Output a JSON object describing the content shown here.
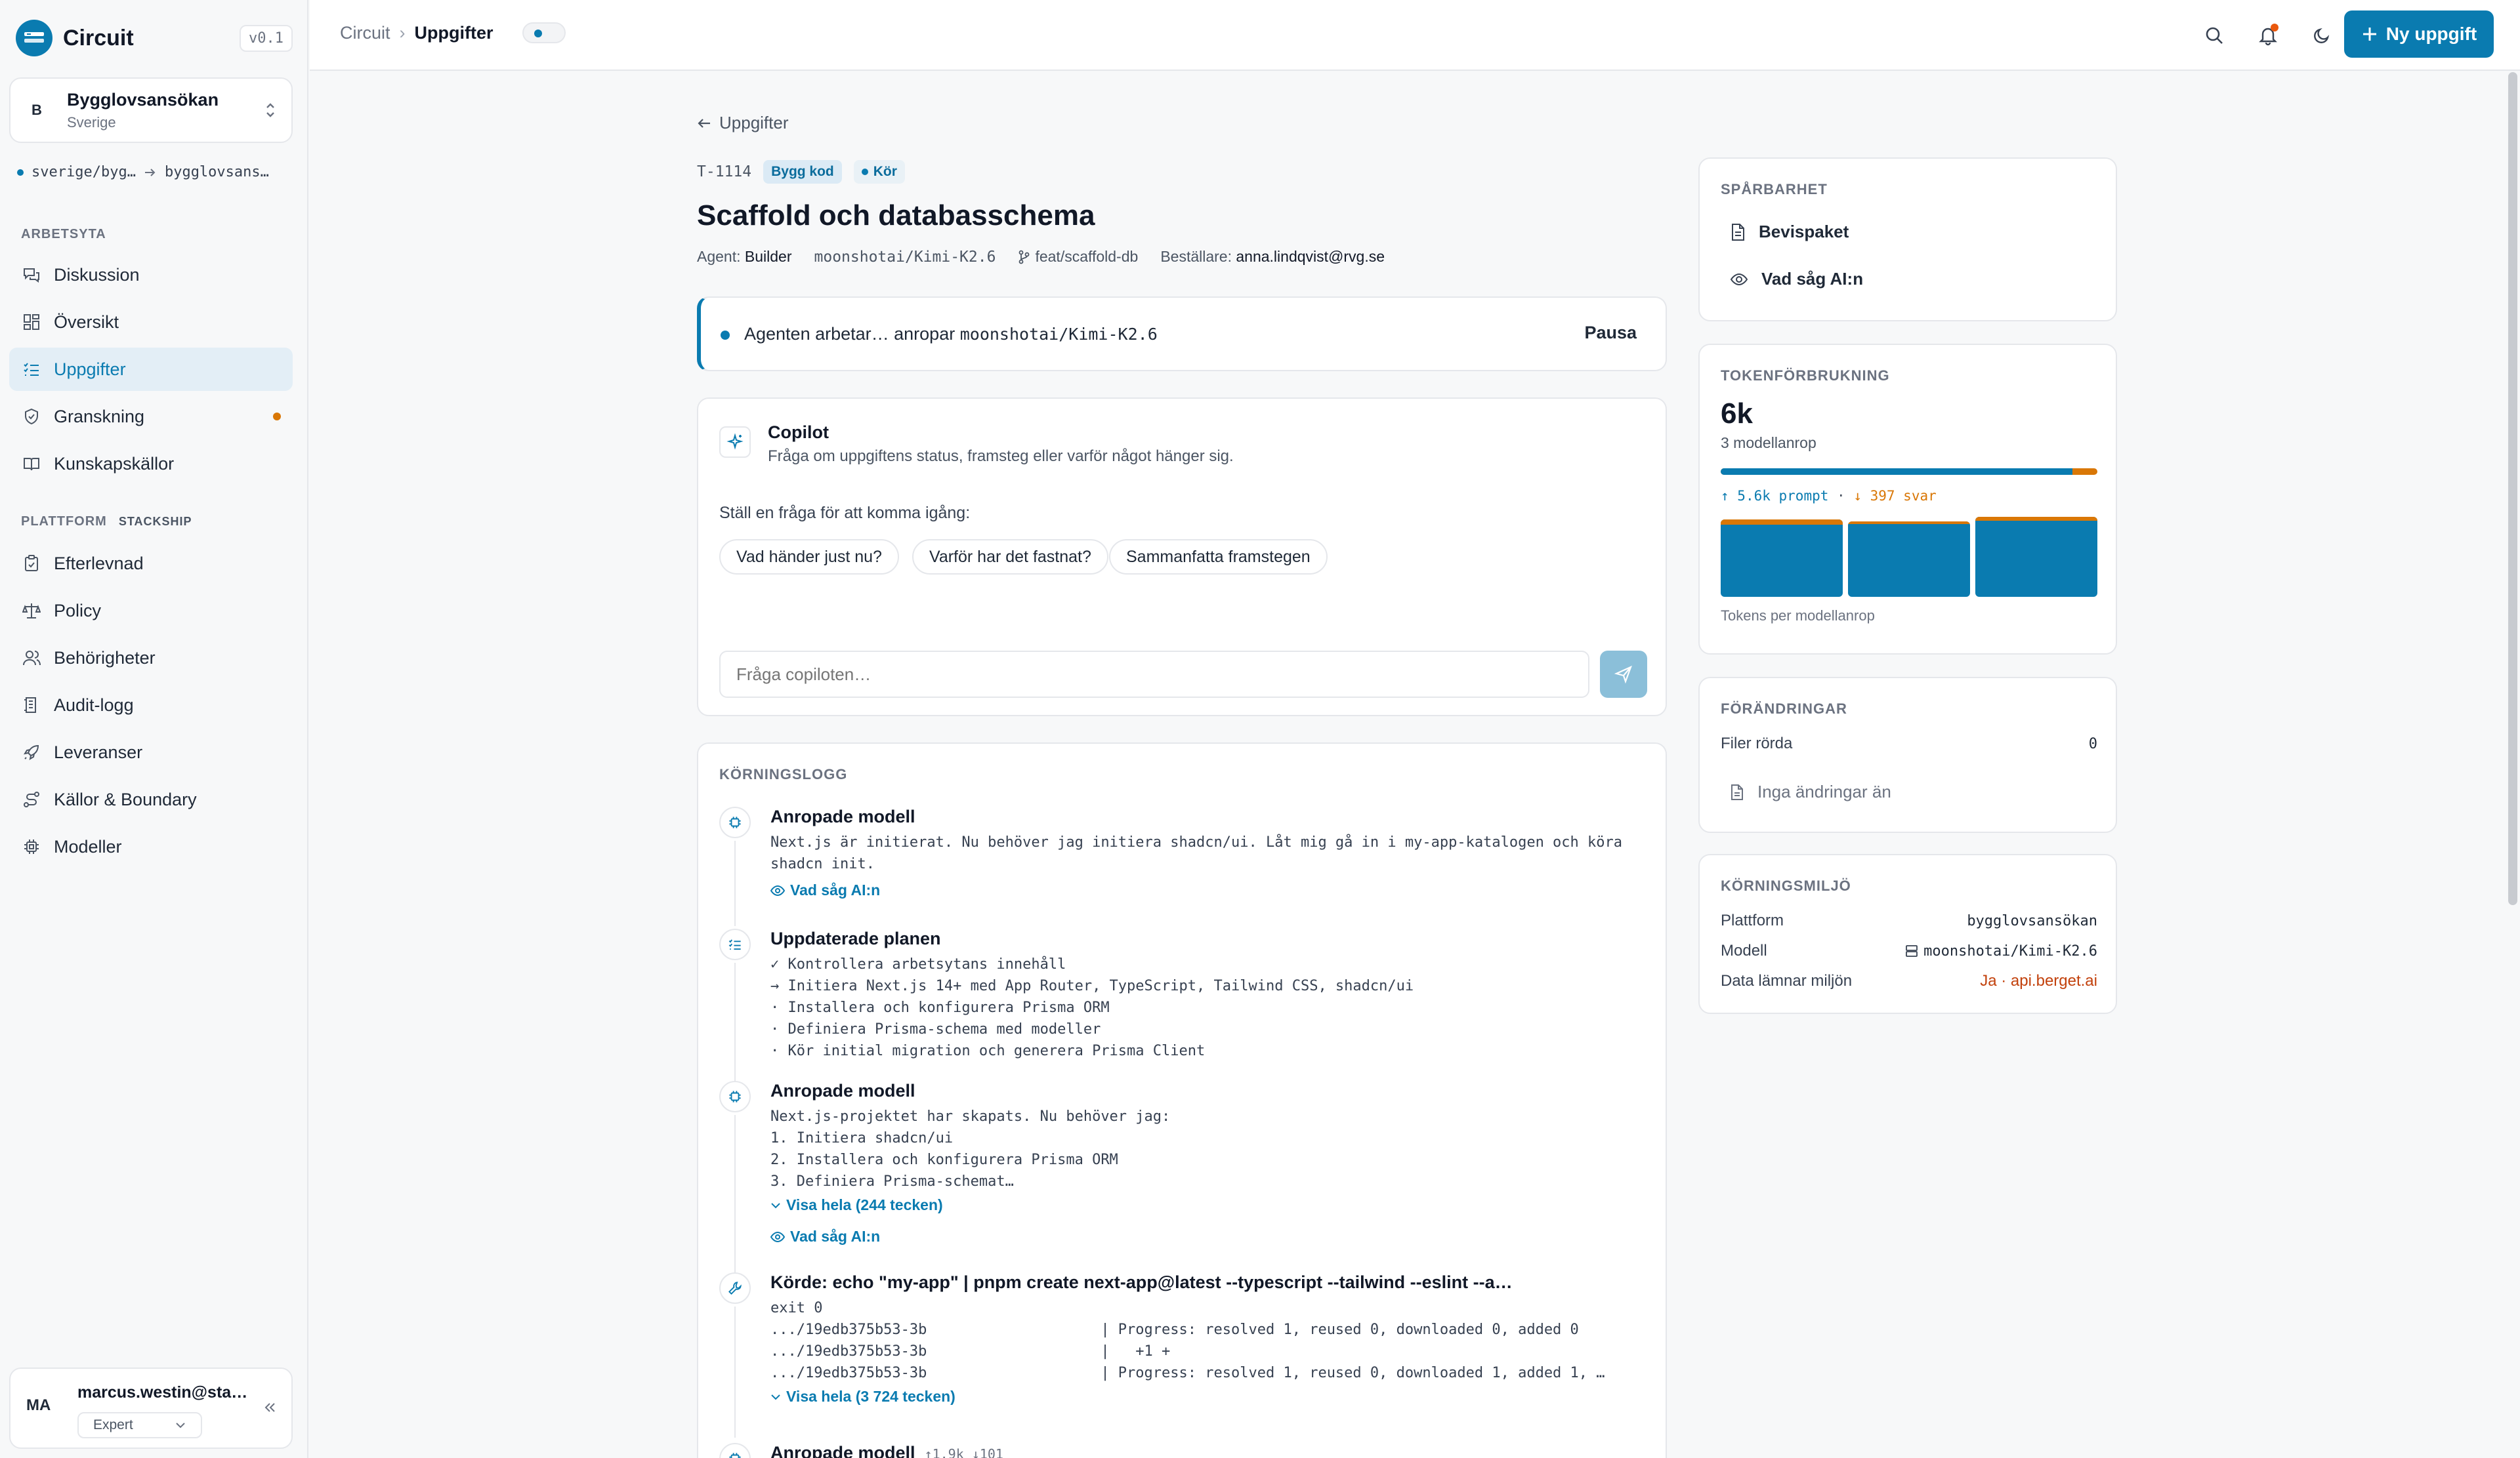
{
  "app": {
    "name": "Circuit",
    "version": "v0.1",
    "logo_icon": "circuit-logo-icon"
  },
  "project": {
    "initial": "B",
    "name": "Bygglovsansökan",
    "region": "Sverige"
  },
  "path": {
    "from": "sverige/byg…",
    "to": "bygglovsans…"
  },
  "sidebar": {
    "workspace_label": "ARBETSYTA",
    "workspace_items": [
      {
        "label": "Diskussion",
        "icon": "chat-icon"
      },
      {
        "label": "Översikt",
        "icon": "grid-icon"
      },
      {
        "label": "Uppgifter",
        "icon": "list-check-icon",
        "active": true
      },
      {
        "label": "Granskning",
        "icon": "shield-check-icon",
        "badge": true
      },
      {
        "label": "Kunskapskällor",
        "icon": "book-icon"
      }
    ],
    "platform_label": "PLATTFORM",
    "platform_tag": "STACKSHIP",
    "platform_items": [
      {
        "label": "Efterlevnad",
        "icon": "clipboard-check-icon"
      },
      {
        "label": "Policy",
        "icon": "scale-icon"
      },
      {
        "label": "Behörigheter",
        "icon": "users-icon"
      },
      {
        "label": "Audit-logg",
        "icon": "log-icon"
      },
      {
        "label": "Leveranser",
        "icon": "rocket-icon"
      },
      {
        "label": "Källor & Boundary",
        "icon": "route-icon"
      },
      {
        "label": "Modeller",
        "icon": "cpu-icon"
      }
    ]
  },
  "user": {
    "initials": "MA",
    "name": "marcus.westin@sta…",
    "role": "Expert"
  },
  "topbar": {
    "crumb_root": "Circuit",
    "crumb_current": "Uppgifter",
    "new_task_label": "Ny uppgift"
  },
  "task": {
    "back_label": "Uppgifter",
    "id": "T-1114",
    "kind_chip": "Bygg kod",
    "status_chip": "Kör",
    "title": "Scaffold och databasschema",
    "agent_label": "Agent:",
    "agent": "Builder",
    "model": "moonshotai/Kimi-K2.6",
    "branch": "feat/scaffold-db",
    "orderer_label": "Beställare:",
    "orderer": "anna.lindqvist@rvg.se"
  },
  "status_banner": {
    "text": "Agenten arbetar… anropar ",
    "model": "moonshotai/Kimi-K2.6",
    "pause_label": "Pausa"
  },
  "copilot": {
    "title": "Copilot",
    "subtitle": "Fråga om uppgiftens status, framsteg eller varför något hänger sig.",
    "hint": "Ställ en fråga för att komma igång:",
    "suggestions": [
      "Vad händer just nu?",
      "Varför har det fastnat?",
      "Sammanfatta framstegen"
    ],
    "placeholder": "Fråga copiloten…"
  },
  "run_log": {
    "heading": "KÖRNINGSLOGG",
    "entries": [
      {
        "title": "Anropade modell",
        "icon": "cpu-icon",
        "body": "Next.js är initierat. Nu behöver jag initiera shadcn/ui. Låt mig gå in i my-app-katalogen och köra\nshadcn init.",
        "ai_link": "Vad såg AI:n"
      },
      {
        "title": "Uppdaterade planen",
        "icon": "list-check-icon",
        "body": "✓ Kontrollera arbetsytans innehåll\n→ Initiera Next.js 14+ med App Router, TypeScript, Tailwind CSS, shadcn/ui\n· Installera och konfigurera Prisma ORM\n· Definiera Prisma-schema med modeller\n· Kör initial migration och generera Prisma Client"
      },
      {
        "title": "Anropade modell",
        "icon": "cpu-icon",
        "body": "Next.js-projektet har skapats. Nu behöver jag:\n1. Initiera shadcn/ui\n2. Installera och konfigurera Prisma ORM\n3. Definiera Prisma-schemat…",
        "expand_link": "Visa hela (244 tecken)",
        "ai_link": "Vad såg AI:n"
      },
      {
        "title": "Körde: echo \"my-app\" | pnpm create next-app@latest --typescript --tailwind --eslint --a…",
        "icon": "wrench-icon",
        "body": "exit 0\n.../19edb375b53-3b                    | Progress: resolved 1, reused 0, downloaded 0, added 0\n.../19edb375b53-3b                    |   +1 +\n.../19edb375b53-3b                    | Progress: resolved 1, reused 0, downloaded 1, added 1, …",
        "expand_link": "Visa hela (3 724 tecken)"
      },
      {
        "title": "Anropade modell",
        "icon": "cpu-icon",
        "stats": "↑1.9k ↓101"
      }
    ]
  },
  "traceability": {
    "heading": "SPÅRBARHET",
    "items": [
      {
        "label": "Bevispaket",
        "icon": "document-icon"
      },
      {
        "label": "Vad såg AI:n",
        "icon": "eye-icon"
      }
    ]
  },
  "tokens": {
    "heading": "TOKENFÖRBRUKNING",
    "total": "6k",
    "calls": "3 modellanrop",
    "prompt_fraction": 0.934,
    "prompt_label": "5.6k prompt",
    "answer_label": "397 svar",
    "per_call_caption": "Tokens per modellanrop",
    "per_call": [
      {
        "total": 1.0,
        "output_share": 0.07
      },
      {
        "total": 0.97,
        "output_share": 0.02
      },
      {
        "total": 1.03,
        "output_share": 0.05
      }
    ]
  },
  "changes": {
    "heading": "FÖRÄNDRINGAR",
    "files_label": "Filer rörda",
    "files_count": "0",
    "empty_label": "Inga ändringar än"
  },
  "environment": {
    "heading": "KÖRNINGSMILJÖ",
    "platform_label": "Plattform",
    "platform": "bygglovsansökan",
    "model_label": "Modell",
    "model": "moonshotai/Kimi-K2.6",
    "egress_label": "Data lämnar miljön",
    "egress": "Ja · api.berget.ai"
  }
}
